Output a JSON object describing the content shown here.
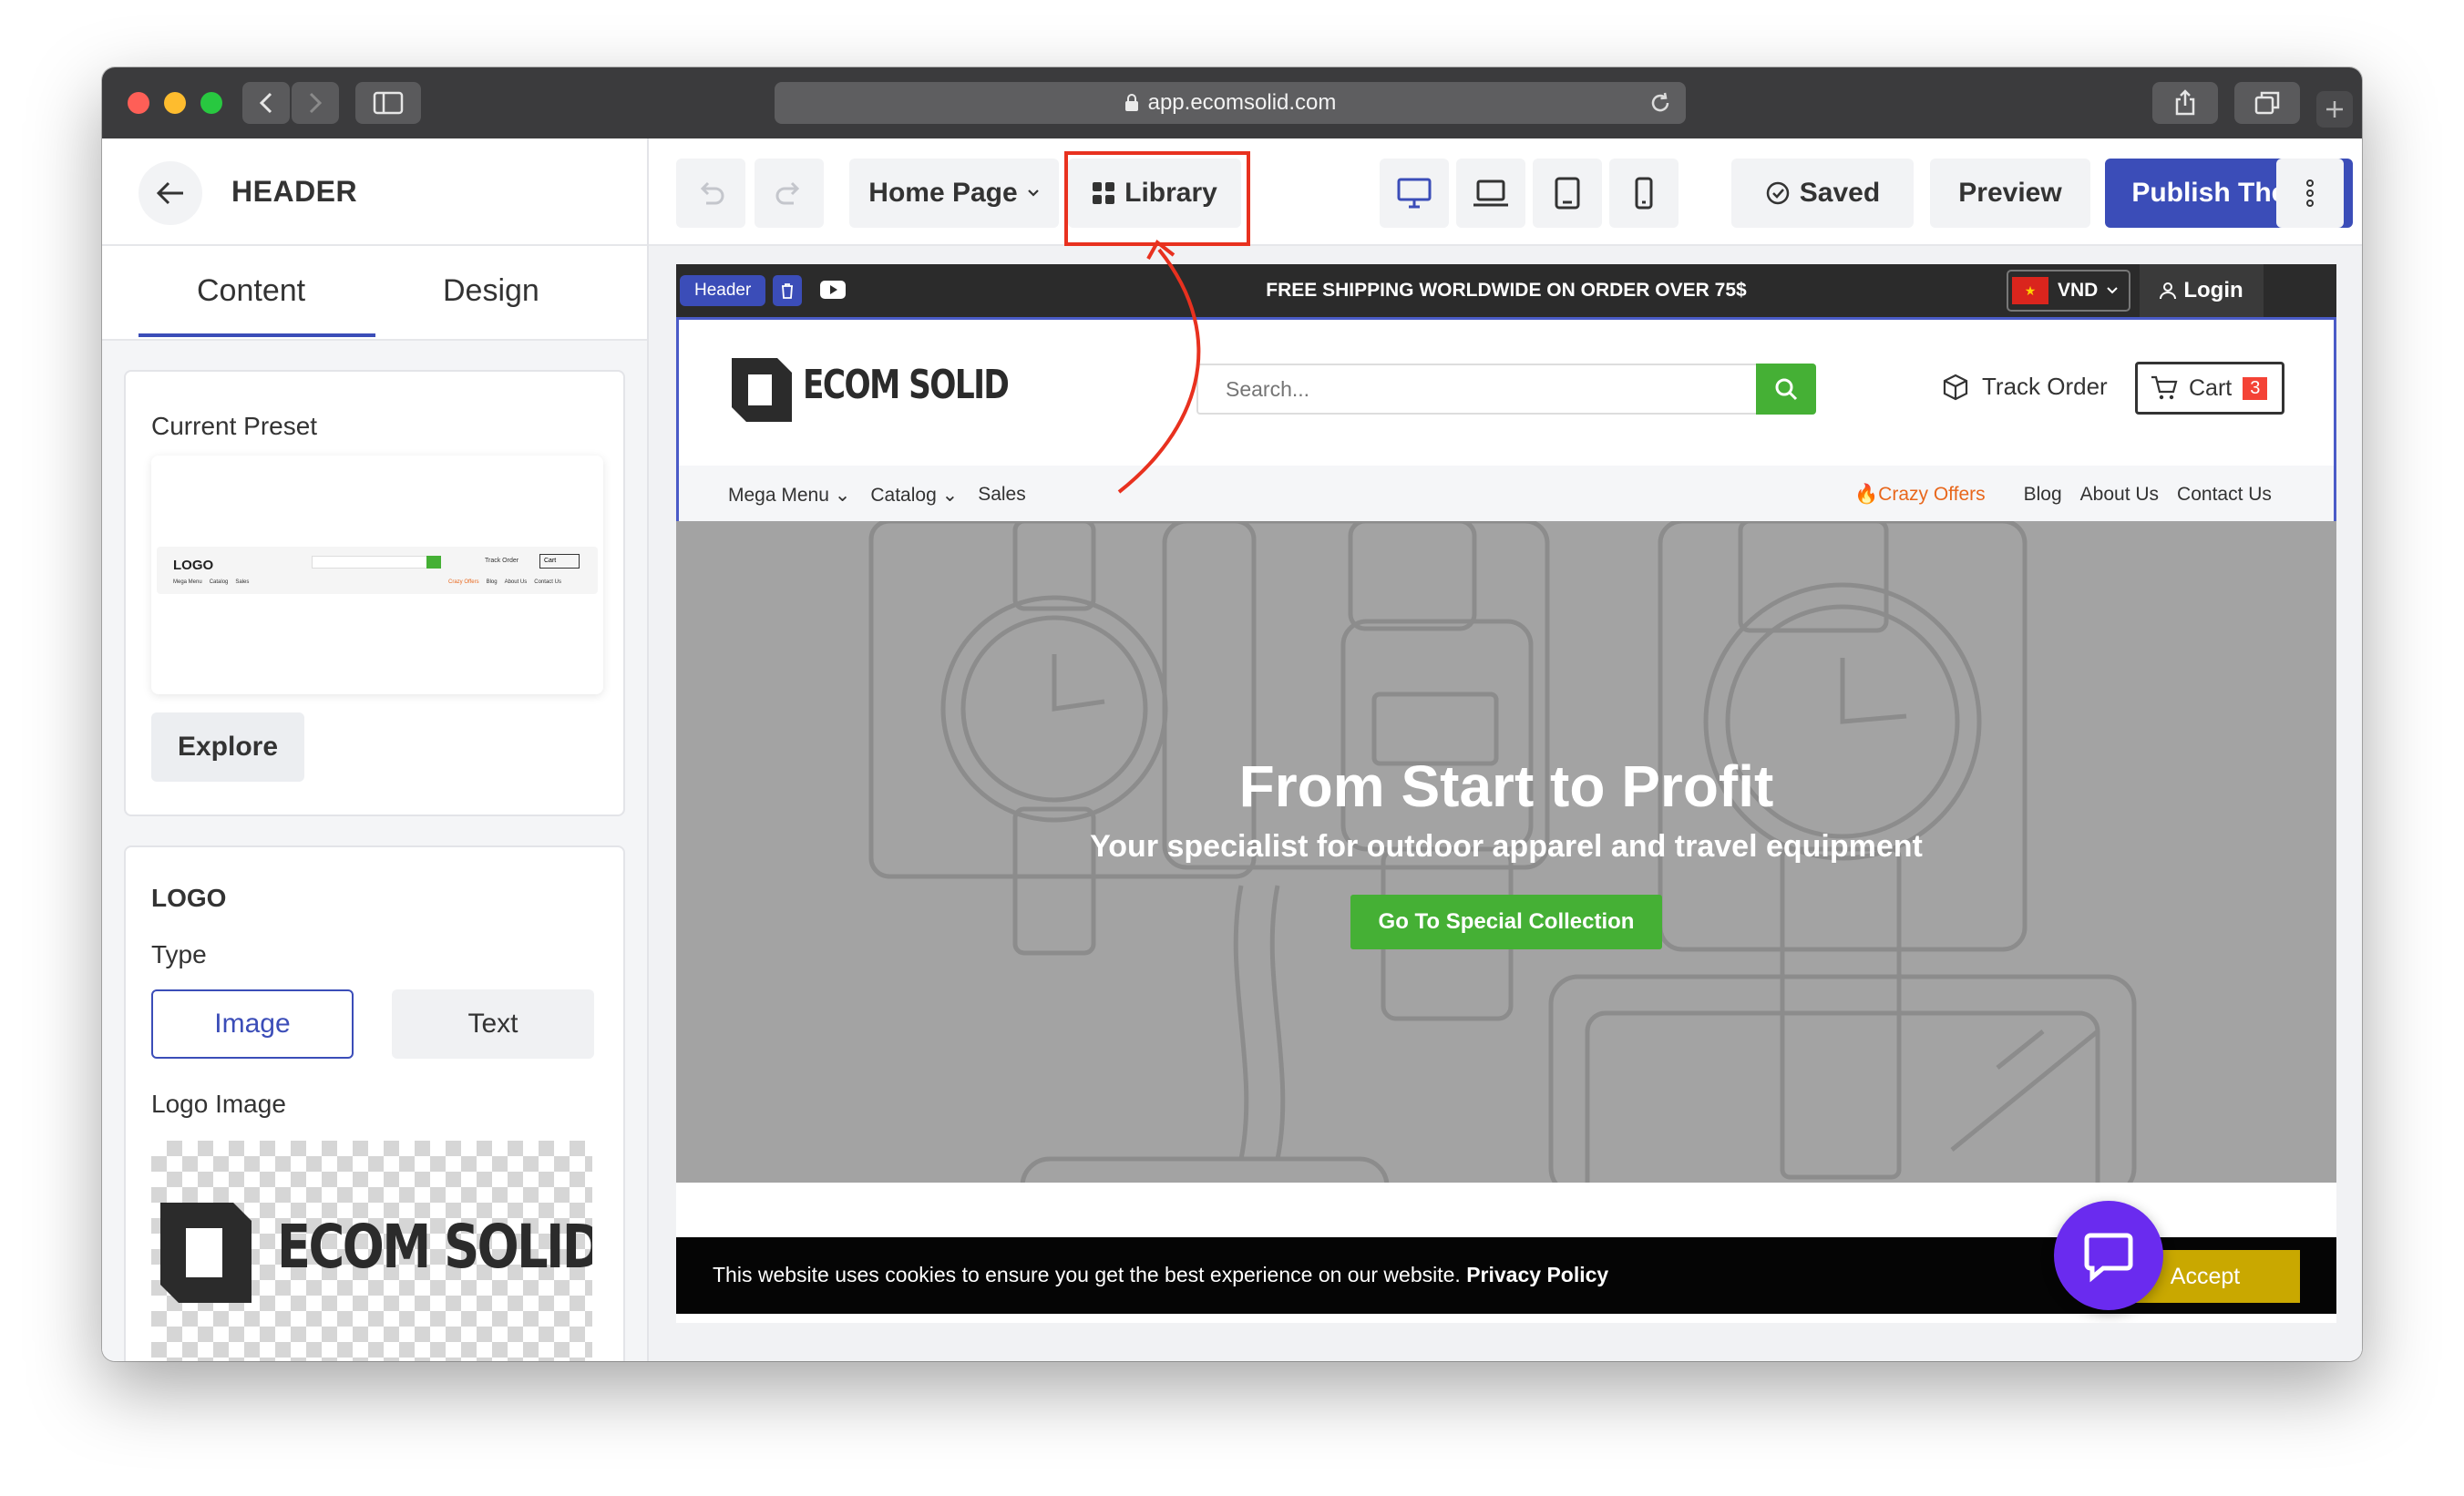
{
  "browser": {
    "url": "app.ecomsolid.com"
  },
  "left_panel": {
    "title": "HEADER",
    "tabs": [
      {
        "label": "Content",
        "active": true
      },
      {
        "label": "Design",
        "active": false
      }
    ],
    "current_preset": {
      "label": "Current Preset",
      "explore_label": "Explore",
      "thumb": {
        "logo": "LOGO",
        "track": "Track Order",
        "cart": "Cart",
        "nav": [
          "Mega Menu",
          "Catalog",
          "Sales"
        ],
        "nav_right": [
          "Crazy Offers",
          "Blog",
          "About Us",
          "Contact Us"
        ]
      }
    },
    "logo_section": {
      "heading": "LOGO",
      "type_label": "Type",
      "type_options": [
        {
          "label": "Image",
          "selected": true
        },
        {
          "label": "Text",
          "selected": false
        }
      ],
      "logo_image_label": "Logo Image",
      "logo_text": "ECOM SOLID"
    }
  },
  "toolbar": {
    "page_selector": "Home Page",
    "library_label": "Library",
    "devices": [
      "desktop",
      "laptop",
      "tablet",
      "mobile"
    ],
    "saved_label": "Saved",
    "preview_label": "Preview",
    "publish_label": "Publish Theme"
  },
  "site": {
    "header_tag": "Header",
    "announcement": "FREE SHIPPING WORLDWIDE ON ORDER OVER 75$",
    "currency": "VND",
    "login_label": "Login",
    "logo_text": "ECOM SOLID",
    "search_placeholder": "Search...",
    "track_order": "Track Order",
    "cart_label": "Cart",
    "cart_count": "3",
    "nav_left": [
      {
        "label": "Mega Menu",
        "dropdown": true
      },
      {
        "label": "Catalog",
        "dropdown": true
      },
      {
        "label": "Sales",
        "dropdown": false
      }
    ],
    "nav_right": [
      "Crazy Offers",
      "Blog",
      "About Us",
      "Contact Us"
    ],
    "hero": {
      "title": "From Start to Profit",
      "subtitle": "Your specialist for outdoor apparel and travel equipment",
      "cta": "Go To Special Collection"
    },
    "cookie": {
      "text": "This website uses cookies to ensure you get the best experience on our website.",
      "link": "Privacy Policy",
      "accept": "Accept"
    }
  },
  "colors": {
    "brand_blue": "#3b4db8",
    "green": "#45b035",
    "annotation_red": "#e8311f",
    "accept_yellow": "#c9a800",
    "chat_purple": "#6a2bef",
    "offers_orange": "#e8671c"
  }
}
